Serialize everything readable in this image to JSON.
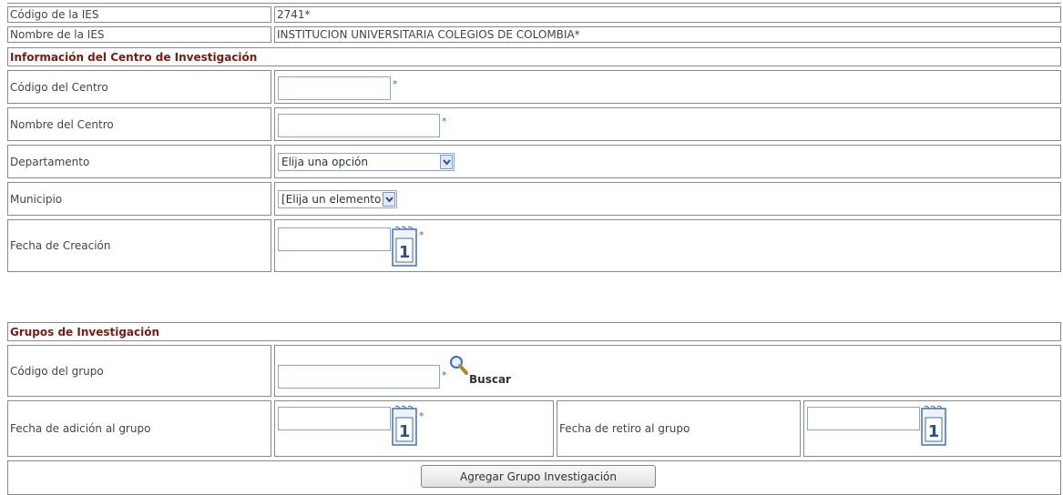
{
  "ies": {
    "code_label": "Código de la IES",
    "code_value": "2741*",
    "name_label": "Nombre de la IES",
    "name_value": "INSTITUCION UNIVERSITARIA COLEGIOS DE COLOMBIA*"
  },
  "centro": {
    "section_title": "Información del Centro de Investigación",
    "codigo_label": "Código del Centro",
    "codigo_value": "",
    "nombre_label": "Nombre del Centro",
    "nombre_value": "",
    "departamento_label": "Departamento",
    "departamento_value": "Elija una opción",
    "municipio_label": "Municipio",
    "municipio_value": "[Elija un elemento]",
    "fecha_label": "Fecha de Creación",
    "fecha_value": "",
    "required_mark": "*"
  },
  "grupos": {
    "section_title": "Grupos de Investigación",
    "codigo_label": "Código del grupo",
    "codigo_value": "",
    "buscar_label": "Buscar",
    "fecha_adicion_label": "Fecha de adición al grupo",
    "fecha_adicion_value": "",
    "fecha_retiro_label": "Fecha de retiro al grupo",
    "fecha_retiro_value": "",
    "agregar_button": "Agregar Grupo Investigación",
    "required_mark": "*"
  },
  "icons": {
    "calendar": "calendar-icon",
    "search": "magnifier-icon",
    "dropdown": "chevron-down-icon"
  },
  "colors": {
    "section_title": "#7a1b10",
    "border": "#8a8a8a",
    "input_border": "#8fa7c4"
  }
}
